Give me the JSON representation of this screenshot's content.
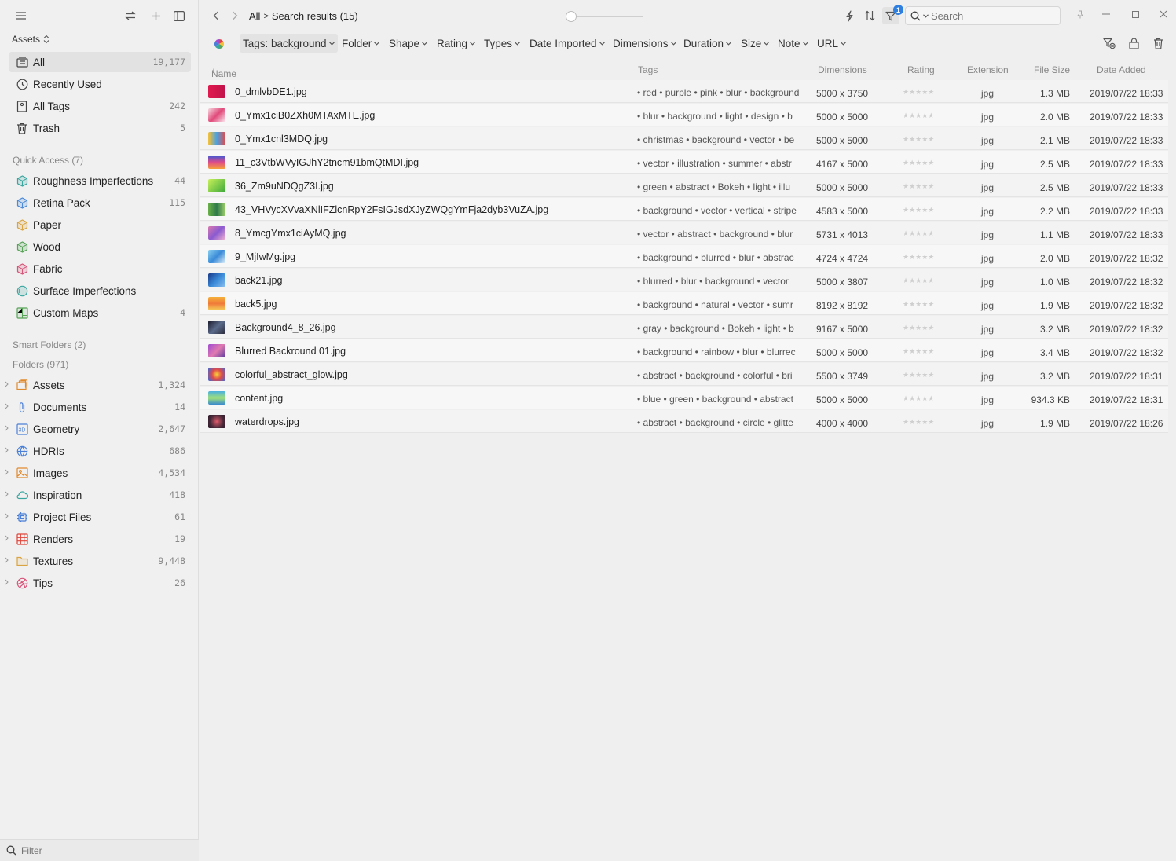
{
  "sidebar": {
    "library_label": "Assets",
    "top_items": [
      {
        "label": "All",
        "count": "19,177",
        "icon": "all-icon"
      },
      {
        "label": "Recently Used",
        "count": "",
        "icon": "clock-icon"
      },
      {
        "label": "All Tags",
        "count": "242",
        "icon": "tag-icon"
      },
      {
        "label": "Trash",
        "count": "5",
        "icon": "trash-icon"
      }
    ],
    "quick_access_title": "Quick Access (7)",
    "quick_access": [
      {
        "label": "Roughness Imperfections",
        "count": "44",
        "color": "#3aa6a0"
      },
      {
        "label": "Retina Pack",
        "count": "115",
        "color": "#4a8ad8"
      },
      {
        "label": "Paper",
        "count": "",
        "color": "#d9a441"
      },
      {
        "label": "Wood",
        "count": "",
        "color": "#57a357"
      },
      {
        "label": "Fabric",
        "count": "",
        "color": "#d8557a"
      },
      {
        "label": "Surface Imperfections",
        "count": "",
        "color": "#3aa6a0"
      },
      {
        "label": "Custom Maps",
        "count": "4",
        "color": "#57a357"
      }
    ],
    "smart_folders_title": "Smart Folders (2)",
    "folders_title": "Folders (971)",
    "folders": [
      {
        "label": "Assets",
        "count": "1,324",
        "icon": "assets-folder-icon",
        "color": "#e08a2e"
      },
      {
        "label": "Documents",
        "count": "14",
        "icon": "paperclip-icon",
        "color": "#4a7fd8"
      },
      {
        "label": "Geometry",
        "count": "2,647",
        "icon": "3d-icon",
        "color": "#4a7fd8"
      },
      {
        "label": "HDRIs",
        "count": "686",
        "icon": "globe-icon",
        "color": "#4a7fd8"
      },
      {
        "label": "Images",
        "count": "4,534",
        "icon": "image-icon",
        "color": "#e08a2e"
      },
      {
        "label": "Inspiration",
        "count": "418",
        "icon": "cloud-icon",
        "color": "#3aa6a0"
      },
      {
        "label": "Project Files",
        "count": "61",
        "icon": "chip-icon",
        "color": "#4a7fd8"
      },
      {
        "label": "Renders",
        "count": "19",
        "icon": "grid-icon",
        "color": "#e0443a"
      },
      {
        "label": "Textures",
        "count": "9,448",
        "icon": "folder-icon",
        "color": "#d9a441"
      },
      {
        "label": "Tips",
        "count": "26",
        "icon": "dribbble-icon",
        "color": "#d8557a"
      }
    ],
    "filter_placeholder": "Filter"
  },
  "toolbar": {
    "crumb_root": "All",
    "crumb_current": "Search results (15)",
    "filter_badge": "1",
    "search_placeholder": "Search"
  },
  "filters": [
    {
      "label": "Tags: background",
      "active": true
    },
    {
      "label": "Folder"
    },
    {
      "label": "Shape"
    },
    {
      "label": "Rating"
    },
    {
      "label": "Types"
    },
    {
      "label": "Date Imported"
    },
    {
      "label": "Dimensions"
    },
    {
      "label": "Duration"
    },
    {
      "label": "Size"
    },
    {
      "label": "Note"
    },
    {
      "label": "URL"
    }
  ],
  "table": {
    "columns": {
      "name": "Name",
      "tags": "Tags",
      "dimensions": "Dimensions",
      "rating": "Rating",
      "extension": "Extension",
      "file_size": "File Size",
      "date_added": "Date Added"
    },
    "rows": [
      {
        "name": "0_dmlvbDE1.jpg",
        "tags": "• red  • purple  • pink  • blur  • background",
        "dims": "5000 x 3750",
        "rating": "★★★★★",
        "ext": "jpg",
        "size": "1.3 MB",
        "date": "2019/07/22 18:33",
        "thumb": "linear-gradient(90deg,#e01a4f,#c0134a)"
      },
      {
        "name": "0_Ymx1ciB0ZXh0MTAxMTE.jpg",
        "tags": "• blur  • background  • light  • design  • b",
        "dims": "5000 x 5000",
        "rating": "★★★★★",
        "ext": "jpg",
        "size": "2.0 MB",
        "date": "2019/07/22 18:33",
        "thumb": "linear-gradient(135deg,#f7d6e0,#e04a7a,#fbe7ef)"
      },
      {
        "name": "0_Ymx1cnl3MDQ.jpg",
        "tags": "• christmas  • background  • vector  • be",
        "dims": "5000 x 5000",
        "rating": "★★★★★",
        "ext": "jpg",
        "size": "2.1 MB",
        "date": "2019/07/22 18:33",
        "thumb": "linear-gradient(90deg,#f5c13a,#4aa0e0,#e04a4a)"
      },
      {
        "name": "11_c3VtbWVyIGJhY2tncm91bmQtMDI.jpg",
        "tags": "• vector  • illustration  • summer  • abstr",
        "dims": "4167 x 5000",
        "rating": "★★★★★",
        "ext": "jpg",
        "size": "2.5 MB",
        "date": "2019/07/22 18:33",
        "thumb": "linear-gradient(180deg,#3a5ad8,#e04a8a,#f5a23a)"
      },
      {
        "name": "36_Zm9uNDQgZ3I.jpg",
        "tags": "• green  • abstract  • Bokeh  • light  • illu",
        "dims": "5000 x 5000",
        "rating": "★★★★★",
        "ext": "jpg",
        "size": "2.5 MB",
        "date": "2019/07/22 18:33",
        "thumb": "linear-gradient(135deg,#c8f05a,#3aa83a)"
      },
      {
        "name": "43_VHVycXVvaXNlIFZlcnRpY2FsIGJsdXJyZWQgYmFja2dyb3VuZA.jpg",
        "tags": "• background  • vector  • vertical  • stripe",
        "dims": "4583 x 5000",
        "rating": "★★★★★",
        "ext": "jpg",
        "size": "2.2 MB",
        "date": "2019/07/22 18:33",
        "thumb": "linear-gradient(90deg,#6ab04a,#2e7a4a,#a0d06a)"
      },
      {
        "name": "8_YmcgYmx1ciAyMQ.jpg",
        "tags": "• vector  • abstract  • background  • blur",
        "dims": "5731 x 4013",
        "rating": "★★★★★",
        "ext": "jpg",
        "size": "1.1 MB",
        "date": "2019/07/22 18:33",
        "thumb": "linear-gradient(135deg,#d87ab0,#8a5ad0,#f0b0d0)"
      },
      {
        "name": "9_MjIwMg.jpg",
        "tags": "• background  • blurred  • blur  • abstrac",
        "dims": "4724 x 4724",
        "rating": "★★★★★",
        "ext": "jpg",
        "size": "2.0 MB",
        "date": "2019/07/22 18:32",
        "thumb": "linear-gradient(135deg,#8ad0f0,#3a8ad8,#e0f0fa)"
      },
      {
        "name": "back21.jpg",
        "tags": "• blurred  • blur  • background  • vector",
        "dims": "5000 x 3807",
        "rating": "★★★★★",
        "ext": "jpg",
        "size": "1.0 MB",
        "date": "2019/07/22 18:32",
        "thumb": "linear-gradient(135deg,#1a3a8a,#3a8ad8,#8ac0f0)"
      },
      {
        "name": "back5.jpg",
        "tags": "• background  • natural  • vector  • sumr",
        "dims": "8192 x 8192",
        "rating": "★★★★★",
        "ext": "jpg",
        "size": "1.9 MB",
        "date": "2019/07/22 18:32",
        "thumb": "linear-gradient(180deg,#f5b03a,#f07a3a,#f5d05a)"
      },
      {
        "name": "Background4_8_26.jpg",
        "tags": "• gray  • background  • Bokeh  • light  • b",
        "dims": "9167 x 5000",
        "rating": "★★★★★",
        "ext": "jpg",
        "size": "3.2 MB",
        "date": "2019/07/22 18:32",
        "thumb": "linear-gradient(135deg,#1a1a2a,#5a6a8a,#2a2a3a)"
      },
      {
        "name": "Blurred Backround 01.jpg",
        "tags": "• background  • rainbow  • blur  • blurrec",
        "dims": "5000 x 5000",
        "rating": "★★★★★",
        "ext": "jpg",
        "size": "3.4 MB",
        "date": "2019/07/22 18:32",
        "thumb": "linear-gradient(135deg,#a04ad0,#e07ab0,#5a3aa0)"
      },
      {
        "name": "colorful_abstract_glow.jpg",
        "tags": "• abstract  • background  • colorful  • bri",
        "dims": "5500 x 3749",
        "rating": "★★★★★",
        "ext": "jpg",
        "size": "3.2 MB",
        "date": "2019/07/22 18:31",
        "thumb": "radial-gradient(circle,#f5d03a,#e04a4a 45%,#3a6ad8)"
      },
      {
        "name": "content.jpg",
        "tags": "• blue  • green  • background  • abstract",
        "dims": "5000 x 5000",
        "rating": "★★★★★",
        "ext": "jpg",
        "size": "934.3 KB",
        "date": "2019/07/22 18:31",
        "thumb": "linear-gradient(180deg,#4ab0e0,#a0e07a,#3a8ad0)"
      },
      {
        "name": "waterdrops.jpg",
        "tags": "• abstract  • background  • circle  • glitte",
        "dims": "4000 x 4000",
        "rating": "★★★★★",
        "ext": "jpg",
        "size": "1.9 MB",
        "date": "2019/07/22 18:26",
        "thumb": "radial-gradient(circle,#e05a6a,#4a2a3a 60%,#2a1a2a)"
      }
    ]
  }
}
